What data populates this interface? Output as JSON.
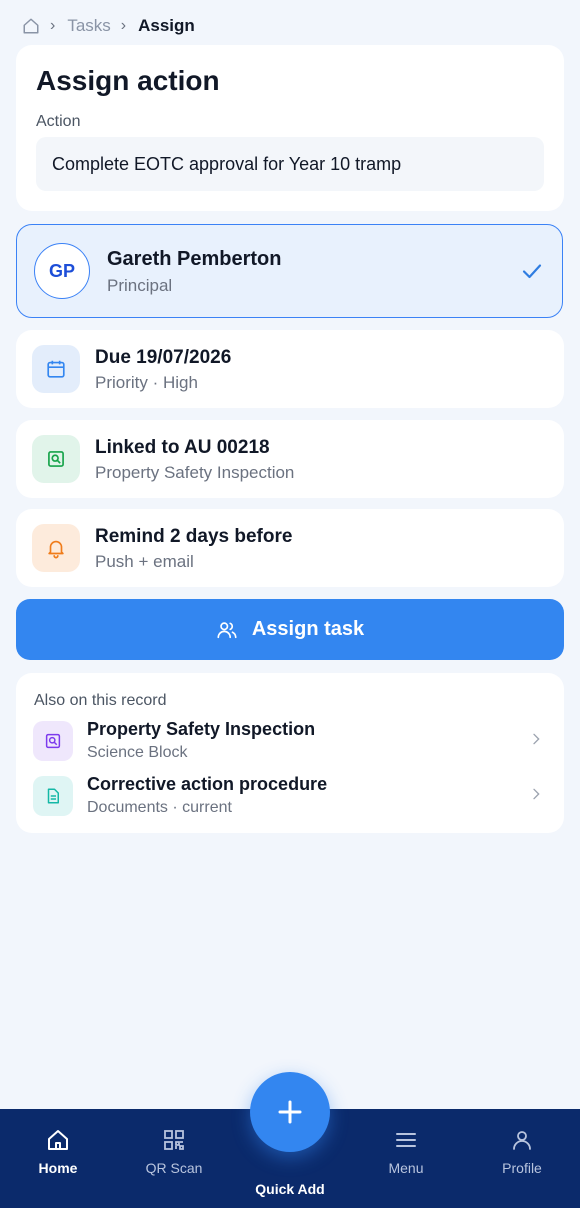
{
  "breadcrumb": {
    "items": [
      "Tasks",
      "Assign"
    ]
  },
  "assign": {
    "title": "Assign action",
    "action_label": "Action",
    "action_value": "Complete EOTC approval for Year 10 tramp"
  },
  "assignee": {
    "initials": "GP",
    "name": "Gareth Pemberton",
    "role": "Principal"
  },
  "details": [
    {
      "title": "Due 19/07/2026",
      "subtitle": "Priority · High",
      "icon": "calendar-icon"
    },
    {
      "title": "Linked to AU 00218",
      "subtitle": "Property Safety Inspection",
      "icon": "inspection-icon"
    },
    {
      "title": "Remind 2 days before",
      "subtitle": "Push + email",
      "icon": "bell-icon"
    }
  ],
  "assign_button": {
    "label": "Assign task"
  },
  "also": {
    "heading": "Also on this record",
    "items": [
      {
        "title": "Property Safety Inspection",
        "subtitle": "Science Block",
        "icon": "inspection-icon"
      },
      {
        "title": "Corrective action procedure",
        "subtitle": "Documents · current",
        "icon": "document-icon"
      }
    ]
  },
  "nav": {
    "items": [
      "Home",
      "QR Scan",
      "Menu",
      "Profile"
    ],
    "quick_add": "Quick Add"
  },
  "colors": {
    "accent": "#3386f0",
    "nav_bg": "#0b2a6b",
    "selected_bg": "#e8f1fd"
  }
}
